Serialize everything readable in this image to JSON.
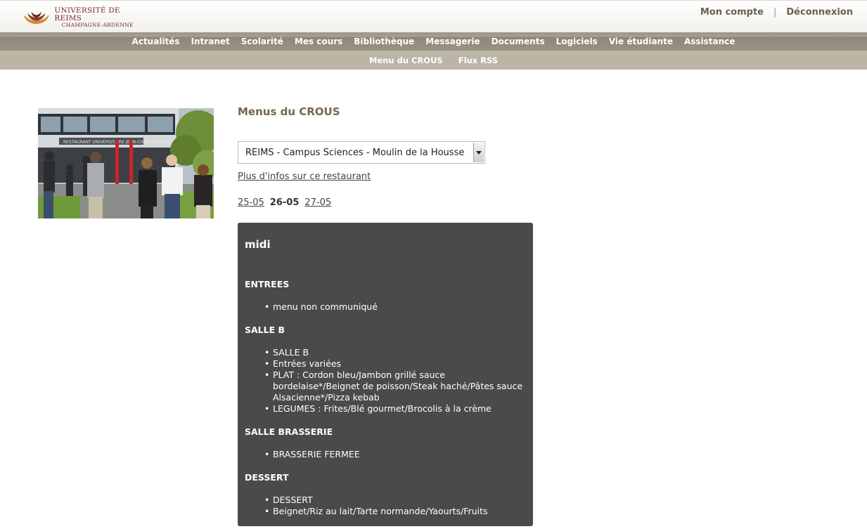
{
  "header": {
    "logo": {
      "line1": "UNIVERSITÉ DE REIMS",
      "line2": "CHAMPAGNE-ARDENNE",
      "icon": "fan-logo-icon",
      "color": "#7a2a24"
    },
    "account": {
      "my_account": "Mon compte",
      "separator": "|",
      "logout": "Déconnexion"
    }
  },
  "nav": {
    "primary": [
      {
        "label": "Actualités"
      },
      {
        "label": "Intranet"
      },
      {
        "label": "Scolarité"
      },
      {
        "label": "Mes cours"
      },
      {
        "label": "Bibliothèque"
      },
      {
        "label": "Messagerie"
      },
      {
        "label": "Documents"
      },
      {
        "label": "Logiciels"
      },
      {
        "label": "Vie étudiante"
      },
      {
        "label": "Assistance"
      }
    ],
    "secondary": [
      {
        "label": "Menu du CROUS"
      },
      {
        "label": "Flux RSS"
      }
    ]
  },
  "photo": {
    "sign": "RESTAURANT UNIVERSITAIRE JEAN-CHARLES PROST"
  },
  "main": {
    "title": "Menus du CROUS",
    "restaurant_select": {
      "value": "REIMS - Campus Sciences - Moulin de la Housse"
    },
    "more_info": "Plus d'infos sur ce restaurant",
    "dates": {
      "prev": "25-05",
      "current": "26-05",
      "next": "27-05"
    },
    "menu": {
      "meal": "midi",
      "sections": [
        {
          "title": "ENTREES",
          "items": [
            "menu non communiqué"
          ]
        },
        {
          "title": "SALLE B",
          "items": [
            "SALLE B",
            "Entrées variées",
            "PLAT : Cordon bleu/Jambon grillé sauce bordelaise*/Beignet de poisson/Steak haché/Pâtes sauce Alsacienne*/Pizza kebab",
            "LEGUMES : Frites/Blé gourmet/Brocolis à la crème"
          ]
        },
        {
          "title": "SALLE BRASSERIE",
          "items": [
            "BRASSERIE FERMEE"
          ]
        },
        {
          "title": "DESSERT",
          "items": [
            "DESSERT",
            "Beignet/Riz au lait/Tarte normande/Yaourts/Fruits"
          ]
        }
      ]
    }
  },
  "colors": {
    "nav_primary": "#9a9283",
    "nav_secondary": "#bbb5a6",
    "menu_bg": "#4a4a4a",
    "title": "#74654f"
  }
}
